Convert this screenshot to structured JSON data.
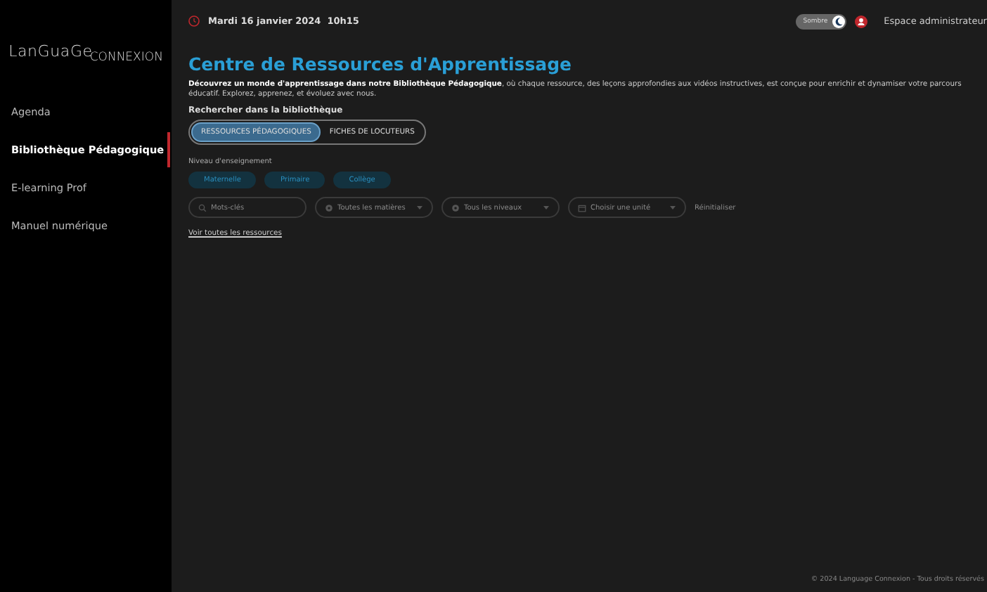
{
  "sidebar": {
    "logo": {
      "top": "LanGuaGe",
      "bottom": "CONNEXION"
    },
    "items": [
      {
        "label": "Agenda",
        "selected": false
      },
      {
        "label": "Bibliothèque Pédagogique",
        "selected": true
      },
      {
        "label": "E-learning Prof",
        "selected": false
      },
      {
        "label": "Manuel numérique",
        "selected": false
      }
    ]
  },
  "header": {
    "date": "Mardi 16 janvier 2024",
    "time": "10h15",
    "theme_toggle": {
      "label": "Sombre",
      "on": true
    },
    "admin_link": "Espace administrateur"
  },
  "page": {
    "title": "Centre de Ressources d'Apprentissage",
    "intro": "**Découvrez un monde d'apprentissage dans notre Bibliothèque Pédagogique**, où chaque ressource, des leçons approfondies aux vidéos instructives, est conçue pour enrichir et dynamiser votre parcours éducatif. Explorez, apprenez, et évoluez avec nous.",
    "search_label": "Rechercher dans la bibliothèque",
    "tabs": [
      {
        "label": "RESSOURCES PÉDAGOGIQUES",
        "selected": true
      },
      {
        "label": "FICHES DE LOCUTEURS",
        "selected": false
      }
    ],
    "level_label": "Niveau d'enseignement",
    "levels": [
      {
        "label": "Maternelle",
        "selected": false
      },
      {
        "label": "Primaire",
        "selected": false
      },
      {
        "label": "Collège",
        "selected": false
      }
    ],
    "filters": [
      {
        "kind": "search",
        "placeholder": "Mots-clés"
      },
      {
        "kind": "select",
        "placeholder": "Toutes les matières"
      },
      {
        "kind": "select",
        "placeholder": "Tous les niveaux"
      },
      {
        "kind": "date",
        "placeholder": "Choisir une unité"
      }
    ],
    "reset": "Réinitialiser",
    "all_link": "Voir toutes les ressources"
  },
  "footer": "© 2024 Language Connexion - Tous droits réservés"
}
